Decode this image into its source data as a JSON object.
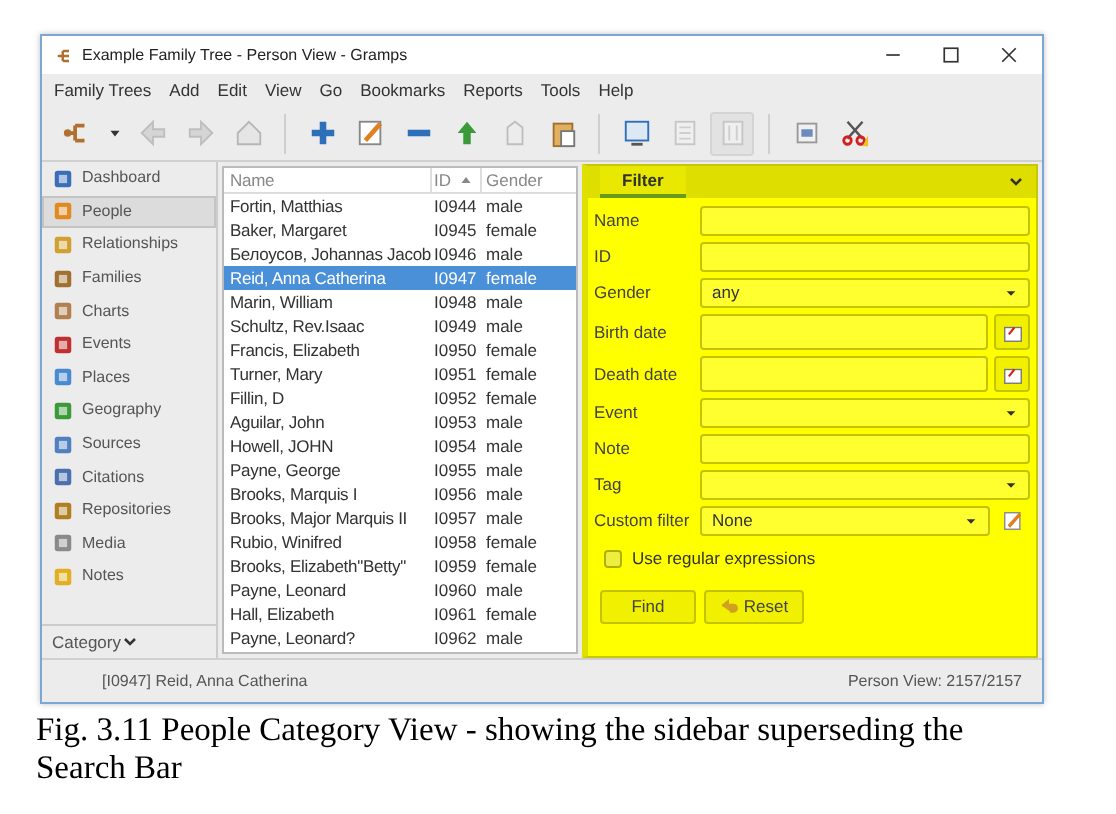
{
  "window": {
    "title": "Example Family Tree - Person View - Gramps"
  },
  "menu": [
    "Family Trees",
    "Add",
    "Edit",
    "View",
    "Go",
    "Bookmarks",
    "Reports",
    "Tools",
    "Help"
  ],
  "toolbar": [
    {
      "kind": "tree",
      "disabled": false,
      "pressed": false
    },
    {
      "kind": "caret",
      "disabled": false,
      "pressed": false
    },
    {
      "kind": "back",
      "disabled": true,
      "pressed": false
    },
    {
      "kind": "forward",
      "disabled": true,
      "pressed": false
    },
    {
      "kind": "home",
      "disabled": true,
      "pressed": false
    },
    {
      "kind": "sep"
    },
    {
      "kind": "add",
      "disabled": false,
      "pressed": false
    },
    {
      "kind": "edit",
      "disabled": false,
      "pressed": false
    },
    {
      "kind": "remove",
      "disabled": false,
      "pressed": false
    },
    {
      "kind": "merge",
      "disabled": false,
      "pressed": false
    },
    {
      "kind": "tag",
      "disabled": true,
      "pressed": false
    },
    {
      "kind": "clipboard",
      "disabled": false,
      "pressed": false
    },
    {
      "kind": "sep"
    },
    {
      "kind": "config",
      "disabled": false,
      "pressed": false
    },
    {
      "kind": "list",
      "disabled": true,
      "pressed": false
    },
    {
      "kind": "grid",
      "disabled": true,
      "pressed": true
    },
    {
      "kind": "sep"
    },
    {
      "kind": "window",
      "disabled": false,
      "pressed": false
    },
    {
      "kind": "scissors",
      "disabled": false,
      "pressed": false
    }
  ],
  "sidebar": {
    "items": [
      {
        "label": "Dashboard",
        "selected": false
      },
      {
        "label": "People",
        "selected": true
      },
      {
        "label": "Relationships",
        "selected": false
      },
      {
        "label": "Families",
        "selected": false
      },
      {
        "label": "Charts",
        "selected": false
      },
      {
        "label": "Events",
        "selected": false
      },
      {
        "label": "Places",
        "selected": false
      },
      {
        "label": "Geography",
        "selected": false
      },
      {
        "label": "Sources",
        "selected": false
      },
      {
        "label": "Citations",
        "selected": false
      },
      {
        "label": "Repositories",
        "selected": false
      },
      {
        "label": "Media",
        "selected": false
      },
      {
        "label": "Notes",
        "selected": false
      }
    ],
    "footer": "Category"
  },
  "table": {
    "columns": [
      {
        "label": "Name",
        "sorted": false
      },
      {
        "label": "ID",
        "sorted": true
      },
      {
        "label": "Gender",
        "sorted": false
      }
    ],
    "rows": [
      {
        "cells": [
          "Fortin, Matthias",
          "I0944",
          "male"
        ],
        "selected": false
      },
      {
        "cells": [
          "Baker, Margaret",
          "I0945",
          "female"
        ],
        "selected": false
      },
      {
        "cells": [
          "Белоусов, Johannas Jacob",
          "I0946",
          "male"
        ],
        "selected": false
      },
      {
        "cells": [
          "Reid, Anna Catherina",
          "I0947",
          "female"
        ],
        "selected": true
      },
      {
        "cells": [
          "Marin, William",
          "I0948",
          "male"
        ],
        "selected": false
      },
      {
        "cells": [
          "Schultz, Rev.Isaac",
          "I0949",
          "male"
        ],
        "selected": false
      },
      {
        "cells": [
          "Francis, Elizabeth",
          "I0950",
          "female"
        ],
        "selected": false
      },
      {
        "cells": [
          "Turner, Mary",
          "I0951",
          "female"
        ],
        "selected": false
      },
      {
        "cells": [
          "Fillin, D",
          "I0952",
          "female"
        ],
        "selected": false
      },
      {
        "cells": [
          "Aguilar, John",
          "I0953",
          "male"
        ],
        "selected": false
      },
      {
        "cells": [
          "Howell, JOHN",
          "I0954",
          "male"
        ],
        "selected": false
      },
      {
        "cells": [
          "Payne, George",
          "I0955",
          "male"
        ],
        "selected": false
      },
      {
        "cells": [
          "Brooks, Marquis I",
          "I0956",
          "male"
        ],
        "selected": false
      },
      {
        "cells": [
          "Brooks, Major Marquis II",
          "I0957",
          "male"
        ],
        "selected": false
      },
      {
        "cells": [
          "Rubio, Winifred",
          "I0958",
          "female"
        ],
        "selected": false
      },
      {
        "cells": [
          "Brooks, Elizabeth\"Betty\"",
          "I0959",
          "female"
        ],
        "selected": false
      },
      {
        "cells": [
          "Payne, Leonard",
          "I0960",
          "male"
        ],
        "selected": false
      },
      {
        "cells": [
          "Hall, Elizabeth",
          "I0961",
          "female"
        ],
        "selected": false
      },
      {
        "cells": [
          "Payne, Leonard?",
          "I0962",
          "male"
        ],
        "selected": false
      }
    ]
  },
  "filter": {
    "tab": "Filter",
    "fields": [
      {
        "label": "Name",
        "kind": "text"
      },
      {
        "label": "ID",
        "kind": "text"
      },
      {
        "label": "Gender",
        "kind": "select",
        "value": "any"
      },
      {
        "label": "Birth date",
        "kind": "date"
      },
      {
        "label": "Death date",
        "kind": "date"
      },
      {
        "label": "Event",
        "kind": "combo"
      },
      {
        "label": "Note",
        "kind": "text"
      },
      {
        "label": "Tag",
        "kind": "select"
      },
      {
        "label": "Custom filter",
        "kind": "select-edit",
        "value": "None"
      }
    ],
    "regex": {
      "label": "Use regular expressions",
      "checked": false
    },
    "buttons": [
      {
        "label": "Find",
        "kind": "plain"
      },
      {
        "label": "Reset",
        "kind": "undo"
      }
    ]
  },
  "status_bar": {
    "left": "[I0947] Reid, Anna Catherina",
    "right": "Person View: 2157/2157"
  },
  "caption": "Fig. 3.11 People Category View - showing the sidebar superseding the Search Bar"
}
